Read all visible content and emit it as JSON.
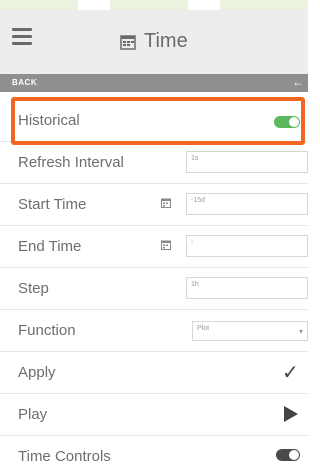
{
  "header": {
    "title": "Time",
    "title_icon": "calendar-icon"
  },
  "backbar": {
    "label": "BACK",
    "arrow": "←"
  },
  "rows": {
    "historical": {
      "label": "Historical",
      "toggle": "on"
    },
    "refresh_interval": {
      "label": "Refresh Interval",
      "value": "1s"
    },
    "start_time": {
      "label": "Start Time",
      "value": "-15d"
    },
    "end_time": {
      "label": "End Time",
      "value": "-"
    },
    "step": {
      "label": "Step",
      "value": "1h"
    },
    "function": {
      "label": "Function",
      "value": "Plot",
      "caret": "▾"
    },
    "apply": {
      "label": "Apply",
      "icon": "checkmark-icon",
      "glyph": "✓"
    },
    "play": {
      "label": "Play",
      "icon": "play-icon"
    },
    "time_controls": {
      "label": "Time Controls",
      "toggle": "off"
    }
  },
  "colors": {
    "accent": "#f26522",
    "toggle_on": "#5cb85c",
    "toggle_off": "#4a4a4a",
    "header_bg": "#ededed",
    "backbar_bg": "#8f8f8f"
  }
}
